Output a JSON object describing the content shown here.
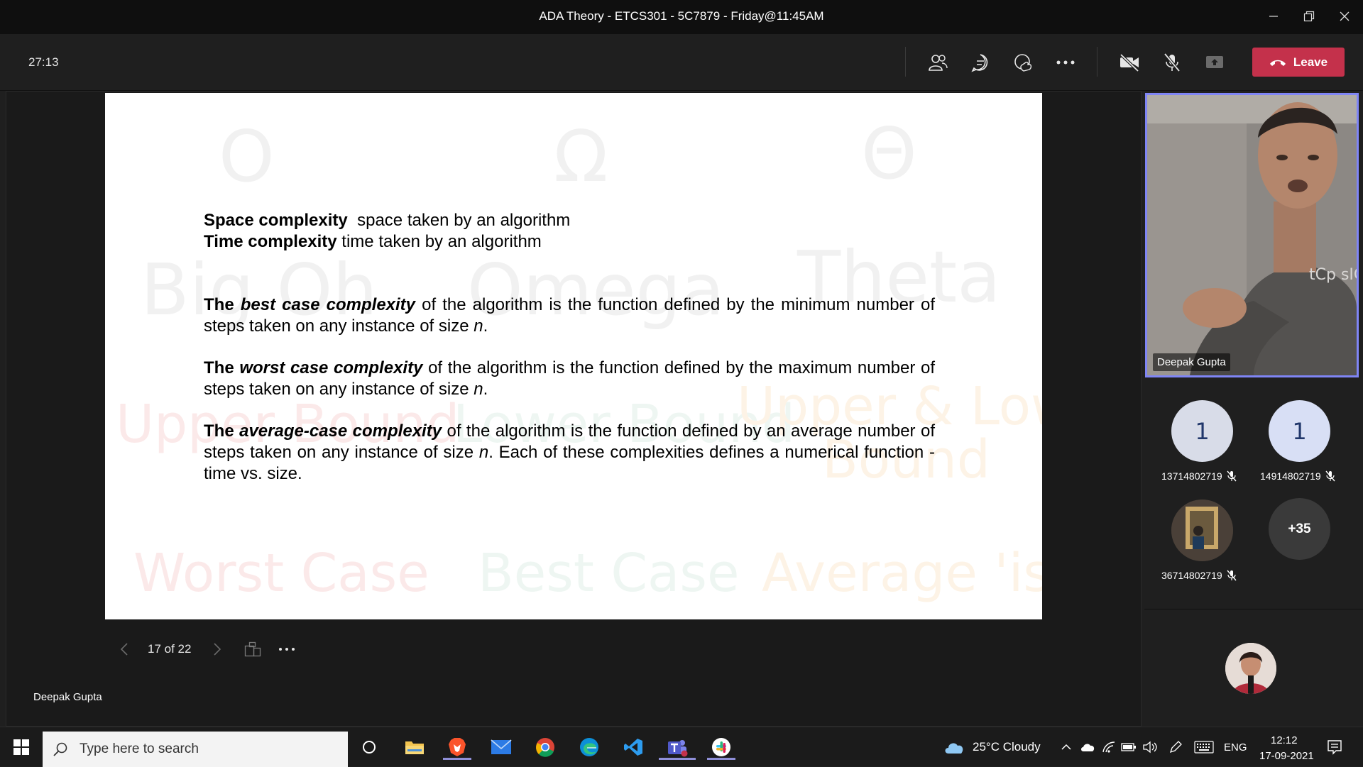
{
  "window": {
    "title": "ADA Theory - ETCS301 - 5C7879 - Friday@11:45AM"
  },
  "toolbar": {
    "timer": "27:13",
    "leave_label": "Leave"
  },
  "slide": {
    "watermarks": {
      "symbols": [
        "O",
        "Ω",
        "Θ"
      ],
      "names": [
        "Big Oh",
        "Omega",
        "Theta"
      ],
      "bounds": [
        "Upper Bound",
        "Lower Bound",
        "Upper & Lower",
        "Bound"
      ],
      "cases": [
        "Worst Case",
        "Best Case",
        "Average 'ish'"
      ]
    },
    "line1_bold": "Space complexity",
    "line1_rest": "  space taken by an algorithm",
    "line2_bold": "Time complexity",
    "line2_rest": " time taken by an algorithm",
    "para1": {
      "the": "The ",
      "term": "best case complexity",
      "text": " of the algorithm is the function defined by the minimum number of steps taken on any instance of size ",
      "n": "n",
      "end": "."
    },
    "para2": {
      "the": "The ",
      "term": "worst case complexity",
      "text": " of the algorithm is the function defined by the maximum number of steps taken on any instance of size ",
      "n": "n",
      "end": "."
    },
    "para3": {
      "the": "The ",
      "term": "average-case complexity",
      "text": " of the algorithm is the function defined by an average number of steps taken on any instance of size ",
      "n": "n",
      "end": ". Each of these complexities defines a numerical function - time vs. size."
    }
  },
  "slide_nav": {
    "counter": "17 of 22"
  },
  "presenter_name": "Deepak Gupta",
  "participants": {
    "video_name": "Deepak Gupta",
    "video_shirt_text": "tCp sIG",
    "p1": {
      "initial": "1",
      "label": "13714802719"
    },
    "p2": {
      "initial": "1",
      "label": "14914802719"
    },
    "p3": {
      "label": "36714802719"
    },
    "more": "+35"
  },
  "taskbar": {
    "search_placeholder": "Type here to search",
    "weather": "25°C  Cloudy",
    "language": "ENG",
    "time": "12:12",
    "date": "17-09-2021"
  },
  "colors": {
    "leave": "#c4314b",
    "active_speaker_border": "#7f85f5",
    "taskbar": "#1b1b1b"
  }
}
